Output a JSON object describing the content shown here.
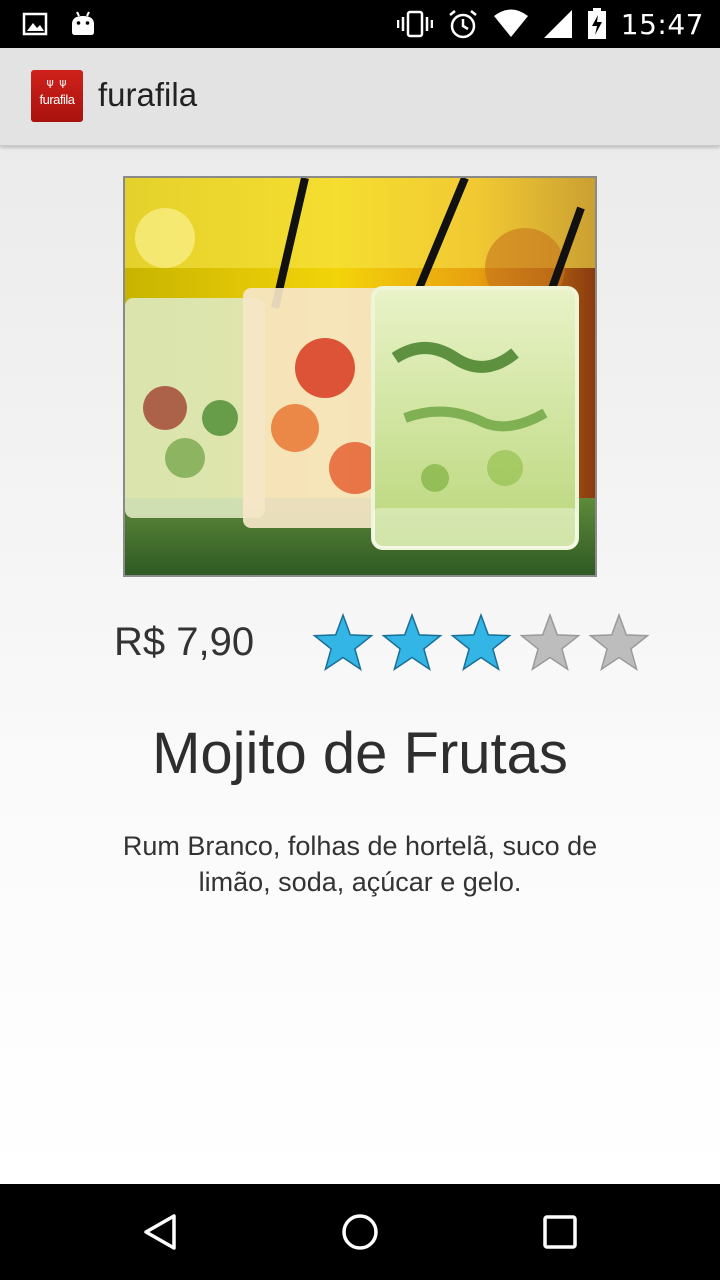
{
  "status_bar": {
    "time": "15:47",
    "left_icons": [
      "image-notification-icon",
      "android-notification-icon"
    ],
    "right_icons": [
      "vibrate-icon",
      "alarm-icon",
      "wifi-icon",
      "cell-signal-icon",
      "battery-charging-icon"
    ]
  },
  "app_bar": {
    "title": "furafila",
    "logo_text": "furafila"
  },
  "item": {
    "price": "R$ 7,90",
    "rating": 3,
    "rating_max": 5,
    "name": "Mojito de Frutas",
    "description": "Rum Branco, folhas de hortelã, suco de limão, soda, açúcar e gelo."
  },
  "colors": {
    "star_filled": "#33b5e5",
    "star_empty": "#bdbdbd",
    "app_bar_bg": "#e3e3e3",
    "logo_bg": "#c41a15"
  },
  "nav_bar": {
    "buttons": [
      "back-icon",
      "home-icon",
      "recents-icon"
    ]
  }
}
